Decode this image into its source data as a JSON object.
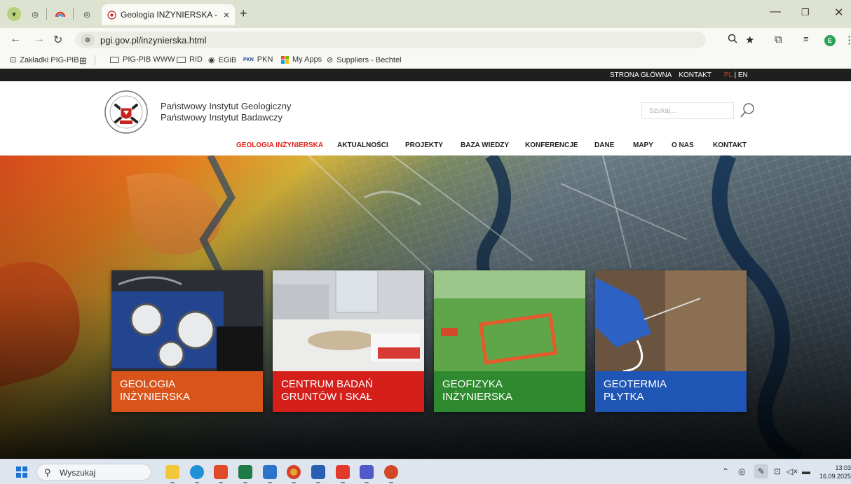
{
  "browser": {
    "tab_title": "Geologia INŻYNIERSKA - Państw",
    "new_tab": "+",
    "tab_close": "×",
    "url": "pgi.gov.pl/inzynierska.html",
    "bookmarks": [
      {
        "label": "Zakładki PIG-PIB",
        "icon": "bookmarks-folder-icon"
      },
      {
        "label": "",
        "icon": "apps-grid-icon"
      },
      {
        "label": "PIG-PIB WWW",
        "icon": "folder-icon"
      },
      {
        "label": "RID",
        "icon": "folder-icon"
      },
      {
        "label": "EGiB",
        "icon": "globe-icon"
      },
      {
        "label": "PKN",
        "icon": "pkn-icon"
      },
      {
        "label": "My Apps",
        "icon": "ms-apps-icon"
      },
      {
        "label": "Suppliers - Bechtel",
        "icon": "link-icon"
      }
    ],
    "profile_initial": "E"
  },
  "site": {
    "top_links": {
      "home": "STRONA GŁÓWNA",
      "contact": "KONTAKT",
      "lang_pl": "PL",
      "lang_sep": "|",
      "lang_en": "EN"
    },
    "institute_line1": "Państwowy Instytut Geologiczny",
    "institute_line2": "Państwowy Instytut Badawczy",
    "search_placeholder": "Szukaj...",
    "nav": [
      {
        "label": "GEOLOGIA INŻYNIERSKA",
        "active": true
      },
      {
        "label": "AKTUALNOŚCI",
        "active": false
      },
      {
        "label": "PROJEKTY",
        "active": false
      },
      {
        "label": "BAZA WIEDZY",
        "active": false
      },
      {
        "label": "KONFERENCJE",
        "active": false
      },
      {
        "label": "DANE",
        "active": false
      },
      {
        "label": "MAPY",
        "active": false
      },
      {
        "label": "O NAS",
        "active": false
      },
      {
        "label": "KONTAKT",
        "active": false
      }
    ],
    "cards": [
      {
        "line1": "GEOLOGIA",
        "line2": "INŻYNIERSKA",
        "color": "#d9541a"
      },
      {
        "line1": "CENTRUM BADAŃ",
        "line2": "GRUNTÓW I SKAŁ",
        "color": "#d41f1a"
      },
      {
        "line1": "GEOFIZYKA",
        "line2": "INŻYNIERSKA",
        "color": "#2f8a2f"
      },
      {
        "line1": "GEOTERMIA",
        "line2": "PŁYTKA",
        "color": "#1f55b5"
      }
    ]
  },
  "taskbar": {
    "search_text": "Wyszukaj",
    "time": "13:03",
    "date": "16.09.2025"
  }
}
